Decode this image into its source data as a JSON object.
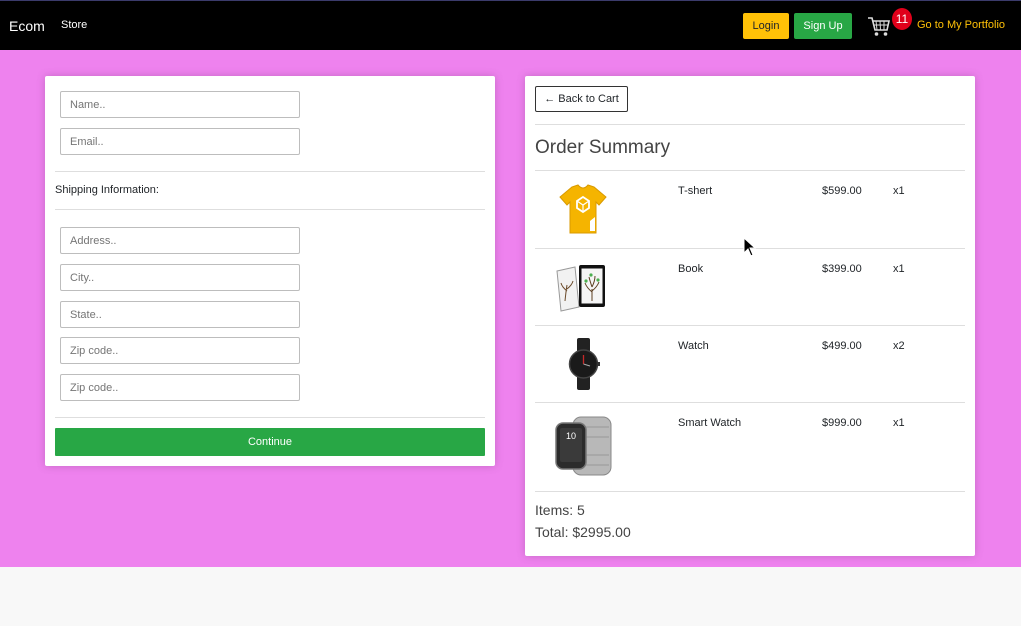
{
  "nav": {
    "brand": "Ecom",
    "store": "Store",
    "login": "Login",
    "signup": "Sign Up",
    "cart_count": "11",
    "portfolio": "Go to My Portfolio"
  },
  "form": {
    "name_placeholder": "Name..",
    "email_placeholder": "Email..",
    "shipping_label": "Shipping Information:",
    "address_placeholder": "Address..",
    "city_placeholder": "City..",
    "state_placeholder": "State..",
    "zip_placeholder": "Zip code..",
    "zip2_placeholder": "Zip code..",
    "continue": "Continue"
  },
  "summary": {
    "back": "← Back to Cart",
    "title": "Order Summary",
    "items": [
      {
        "name": "T-shert",
        "price": "$599.00",
        "qty": "x1",
        "icon": "tshirt-image"
      },
      {
        "name": "Book",
        "price": "$399.00",
        "qty": "x1",
        "icon": "book-image"
      },
      {
        "name": "Watch",
        "price": "$499.00",
        "qty": "x2",
        "icon": "watch-image"
      },
      {
        "name": "Smart Watch",
        "price": "$999.00",
        "qty": "x1",
        "icon": "smartwatch-image"
      }
    ],
    "items_count": "Items: 5",
    "total": "Total: $2995.00"
  },
  "colors": {
    "background": "#ee82ee",
    "navbar": "#000000",
    "login_button": "#ffc107",
    "signup_button": "#28a745",
    "continue_button": "#28a745",
    "badge": "#e0001a",
    "portfolio_link": "#ffc107"
  }
}
